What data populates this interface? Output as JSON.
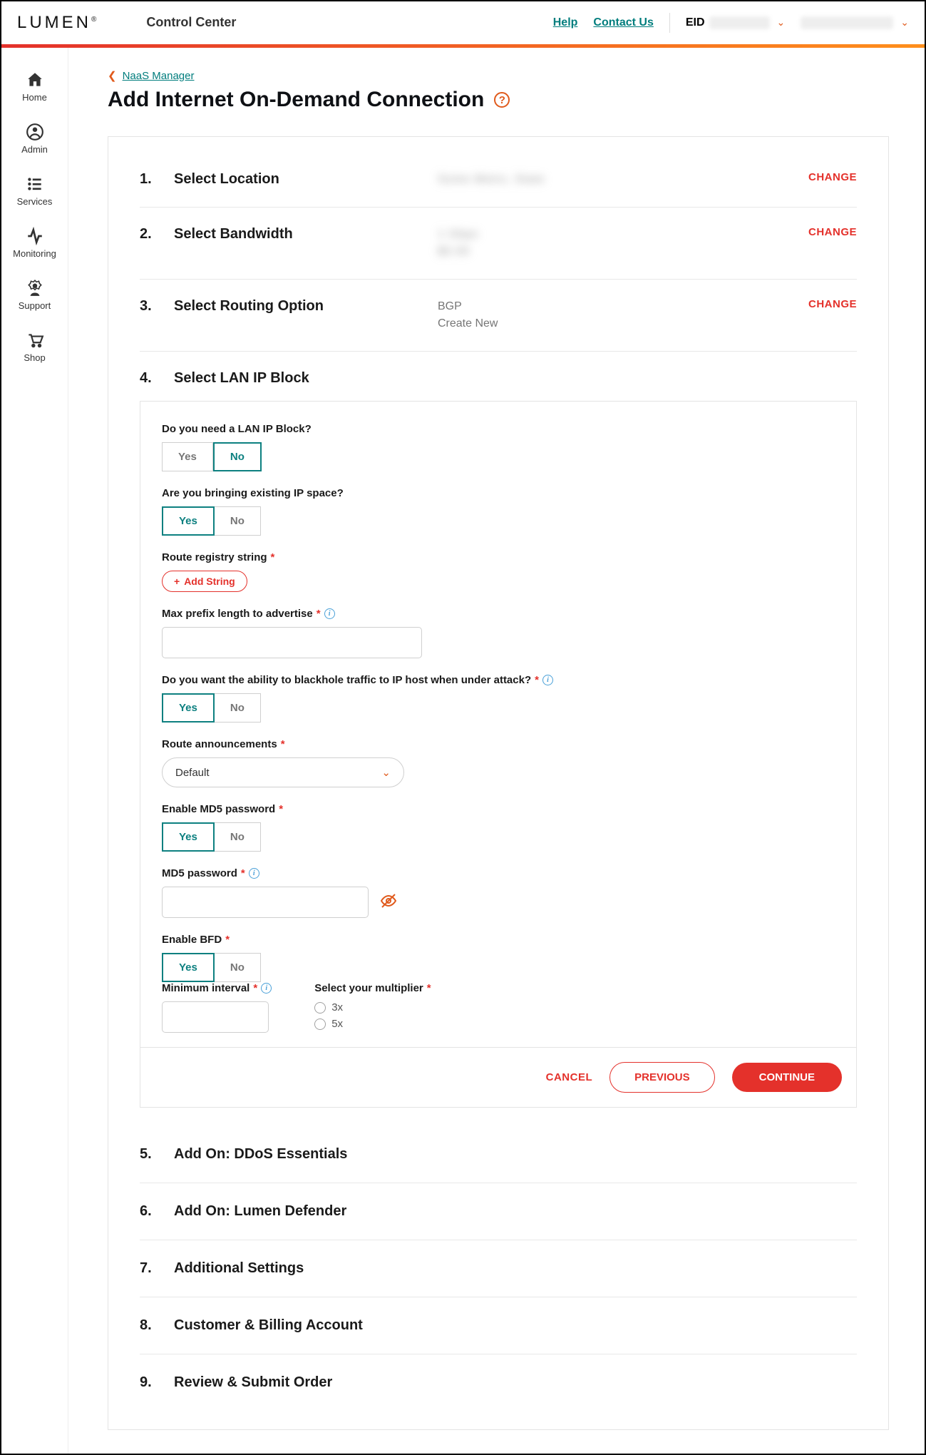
{
  "header": {
    "logo": "LUMEN",
    "app_title": "Control Center",
    "help": "Help",
    "contact": "Contact Us",
    "eid_label": "EID"
  },
  "sidebar": {
    "items": [
      {
        "label": "Home"
      },
      {
        "label": "Admin"
      },
      {
        "label": "Services"
      },
      {
        "label": "Monitoring"
      },
      {
        "label": "Support"
      },
      {
        "label": "Shop"
      }
    ]
  },
  "breadcrumb": {
    "back": "NaaS Manager"
  },
  "page": {
    "title": "Add Internet On-Demand Connection"
  },
  "steps": {
    "s1": {
      "num": "1.",
      "title": "Select Location",
      "change": "CHANGE"
    },
    "s2": {
      "num": "2.",
      "title": "Select Bandwidth",
      "change": "CHANGE"
    },
    "s3": {
      "num": "3.",
      "title": "Select Routing Option",
      "v1": "BGP",
      "v2": "Create New",
      "change": "CHANGE"
    },
    "s4": {
      "num": "4.",
      "title": "Select LAN IP Block"
    },
    "s5": {
      "num": "5.",
      "title": "Add On: DDoS Essentials"
    },
    "s6": {
      "num": "6.",
      "title": "Add On: Lumen Defender"
    },
    "s7": {
      "num": "7.",
      "title": "Additional Settings"
    },
    "s8": {
      "num": "8.",
      "title": "Customer & Billing Account"
    },
    "s9": {
      "num": "9.",
      "title": "Review & Submit Order"
    }
  },
  "form": {
    "need_lan": {
      "label": "Do you need a LAN IP Block?",
      "yes": "Yes",
      "no": "No"
    },
    "bring_ip": {
      "label": "Are you bringing existing IP space?",
      "yes": "Yes",
      "no": "No"
    },
    "route_reg": {
      "label": "Route registry string",
      "add": "Add String"
    },
    "max_prefix": {
      "label": "Max prefix length to advertise"
    },
    "blackhole": {
      "label": "Do you want the ability to blackhole traffic to IP host when under attack?",
      "yes": "Yes",
      "no": "No"
    },
    "route_ann": {
      "label": "Route announcements",
      "value": "Default"
    },
    "md5_en": {
      "label": "Enable MD5 password",
      "yes": "Yes",
      "no": "No"
    },
    "md5_pw": {
      "label": "MD5 password"
    },
    "bfd": {
      "label": "Enable BFD",
      "yes": "Yes",
      "no": "No"
    },
    "min_int": {
      "label": "Minimum interval"
    },
    "mult": {
      "label": "Select your multiplier",
      "o1": "3x",
      "o2": "5x"
    }
  },
  "footer": {
    "cancel": "CANCEL",
    "previous": "PREVIOUS",
    "continue": "CONTINUE"
  }
}
